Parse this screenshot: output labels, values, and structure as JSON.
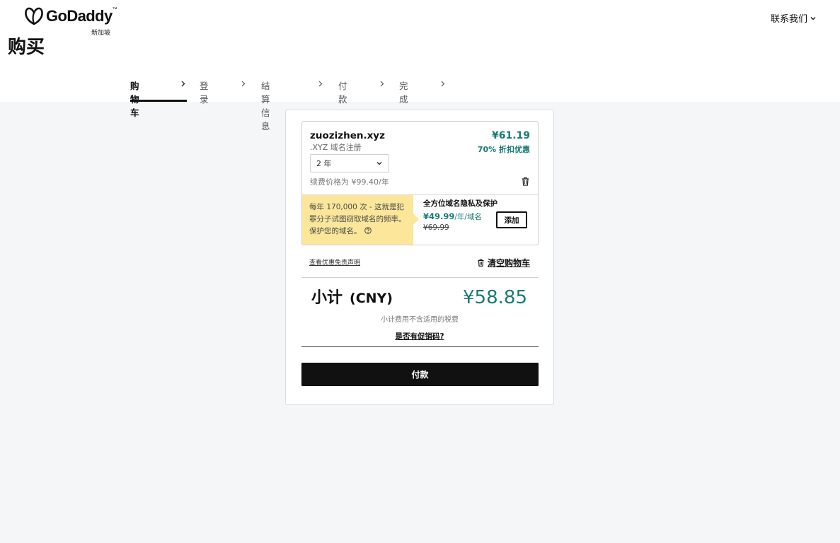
{
  "header": {
    "brand": "GoDaddy",
    "brand_mark": "™",
    "region": "新加坡",
    "contact_label": "联系我们",
    "page_title": "购买"
  },
  "steps": [
    {
      "label": "购物车",
      "active": true
    },
    {
      "label": "登录",
      "active": false
    },
    {
      "label": "结算信息",
      "active": false
    },
    {
      "label": "付款",
      "active": false
    },
    {
      "label": "完成",
      "active": false
    }
  ],
  "cart": {
    "item": {
      "domain": "zuozizhen.xyz",
      "type": ".XYZ 域名注册",
      "price": "¥61.19",
      "discount": "70% 折扣优惠",
      "term": "2 年",
      "renewal": "续费价格为 ¥99.40/年"
    },
    "upsell": {
      "warning": "每年 170,000 次 - 这就是犯罪分子试图窃取域名的频率。保护您的域名。",
      "title": "全方位域名隐私及保护",
      "price": "¥49.99",
      "unit": "/年/域名",
      "old_price": "¥69.99",
      "add_label": "添加"
    },
    "disclaimer_link": "查看优惠免责声明",
    "clear_cart": "清空购物车",
    "subtotal_label": "小计",
    "currency": "(CNY)",
    "subtotal_value": "¥58.85",
    "tax_note": "小计费用不含适用的税费",
    "promo_link": "是否有促销码?",
    "pay_label": "付款"
  },
  "colors": {
    "accent": "#1a7a73",
    "warning_bg": "#fbe69a",
    "primary_button": "#111111"
  },
  "icons": [
    "godaddy-logo-icon",
    "chevron-down-icon",
    "chevron-right-icon",
    "trash-icon",
    "help-circle-icon"
  ]
}
